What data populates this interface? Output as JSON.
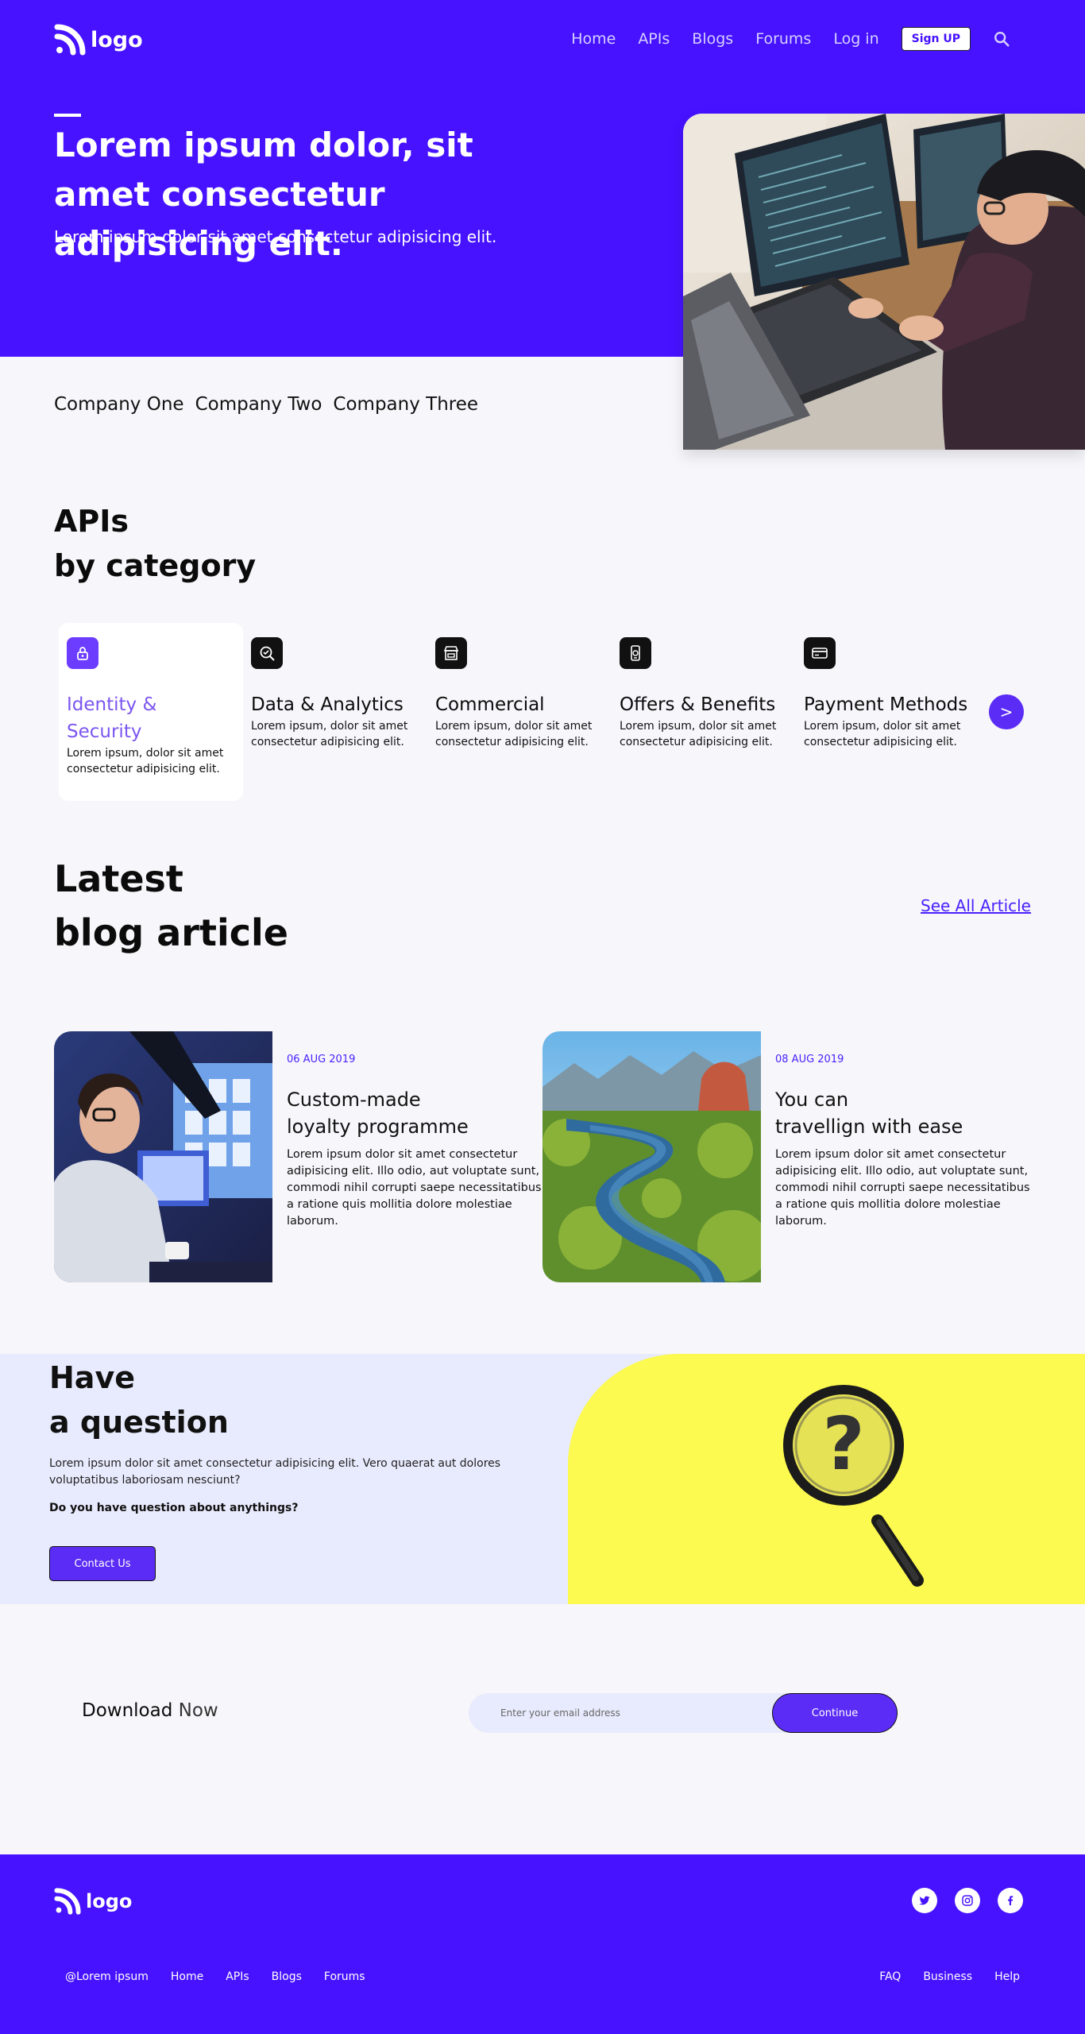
{
  "header": {
    "logo_text": "logo",
    "nav": [
      "Home",
      "APIs",
      "Blogs",
      "Forums",
      "Log in"
    ],
    "signup_label": "Sign UP"
  },
  "hero": {
    "title": "Lorem ipsum dolor, sit amet consectetur adipisicing elit.",
    "subtitle": "Lorem ipsum dolor sit amet consectetur adipisicing elit."
  },
  "companies": [
    "Company One",
    "Company Two",
    "Company Three"
  ],
  "apis": {
    "title_line1": "APIs",
    "title_line2": "by category",
    "categories": [
      {
        "title": "Identity & Security",
        "desc": "Lorem ipsum, dolor sit amet consectetur adipisicing elit.",
        "icon": "lock-icon"
      },
      {
        "title": "Data & Analytics",
        "desc": "Lorem ipsum, dolor sit amet consectetur adipisicing elit.",
        "icon": "analytics-icon"
      },
      {
        "title": "Commercial",
        "desc": "Lorem ipsum, dolor sit amet consectetur adipisicing elit.",
        "icon": "store-icon"
      },
      {
        "title": "Offers & Benefits",
        "desc": "Lorem ipsum, dolor sit amet consectetur adipisicing elit.",
        "icon": "mobile-offer-icon"
      },
      {
        "title": "Payment Methods",
        "desc": "Lorem ipsum, dolor sit amet consectetur adipisicing elit.",
        "icon": "credit-card-icon"
      }
    ],
    "next_label": ">"
  },
  "blog": {
    "title_line1": "Latest",
    "title_line2": "blog article",
    "see_all": "See All Article",
    "articles": [
      {
        "date": "06 AUG 2019",
        "title_line1": "Custom-made",
        "title_line2": "loyalty programme",
        "text": "Lorem ipsum dolor sit amet consectetur adipisicing elit. Illo odio, aut voluptate sunt, commodi nihil corrupti saepe necessitatibus a ratione quis mollitia dolore molestiae laborum."
      },
      {
        "date": "08 AUG 2019",
        "title_line1": "You can",
        "title_line2": "travellign with ease",
        "text": "Lorem ipsum dolor sit amet consectetur adipisicing elit. Illo odio, aut voluptate sunt, commodi nihil corrupti saepe necessitatibus a ratione quis mollitia dolore molestiae laborum."
      }
    ]
  },
  "question": {
    "title_line1": "Have",
    "title_line2": "a question",
    "text": "Lorem ipsum dolor sit amet consectetur adipisicing elit. Vero quaerat aut dolores voluptatibus laboriosam nesciunt?",
    "ask": "Do you have question about anythings?",
    "contact_label": "Contact Us"
  },
  "download": {
    "label_bold": "Download",
    "label_rest": "Now",
    "email_placeholder": "Enter your email address",
    "continue_label": "Continue"
  },
  "footer": {
    "logo_text": "logo",
    "left_links": [
      "@Lorem ipsum",
      "Home",
      "APIs",
      "Blogs",
      "Forums"
    ],
    "right_links": [
      "FAQ",
      "Business",
      "Help"
    ],
    "socials": [
      "twitter-icon",
      "instagram-icon",
      "facebook-icon"
    ]
  },
  "colors": {
    "brand": "#4612ff",
    "accent": "#5b2cf5",
    "question_bg": "#e8ebfd",
    "yellow": "#fcf950"
  }
}
